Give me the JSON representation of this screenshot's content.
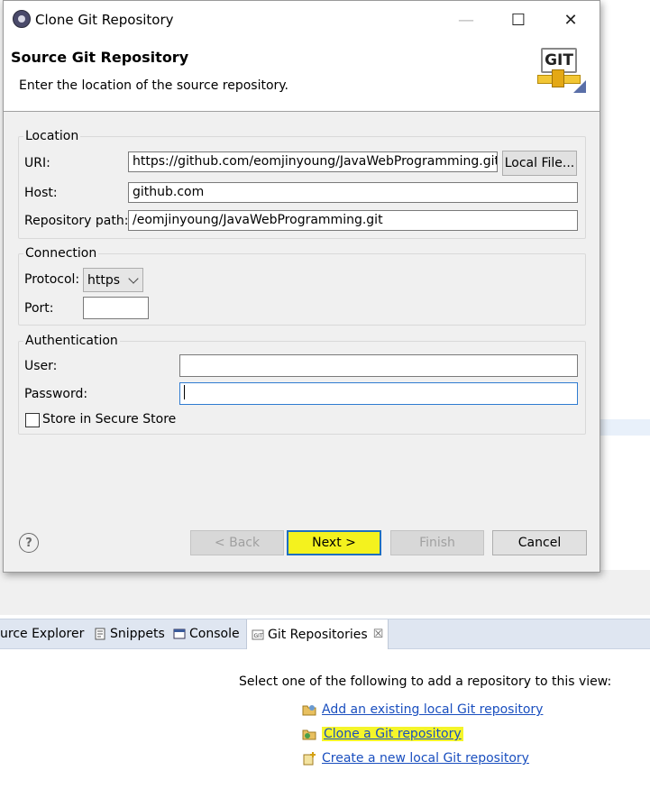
{
  "dialog": {
    "window_title": "Clone Git Repository",
    "controls": {
      "minimize": "—",
      "maximize": "☐",
      "close": "✕"
    },
    "header": {
      "title": "Source Git Repository",
      "description": "Enter the location of the source repository.",
      "logo_text": "GIT"
    },
    "location": {
      "group_label": "Location",
      "uri_label": "URI:",
      "uri_value": "https://github.com/eomjinyoung/JavaWebProgramming.git",
      "local_file_button": "Local File...",
      "host_label": "Host:",
      "host_value": "github.com",
      "repo_path_label": "Repository path:",
      "repo_path_value": "/eomjinyoung/JavaWebProgramming.git"
    },
    "connection": {
      "group_label": "Connection",
      "protocol_label": "Protocol:",
      "protocol_value": "https",
      "port_label": "Port:",
      "port_value": ""
    },
    "authentication": {
      "group_label": "Authentication",
      "user_label": "User:",
      "user_value": "",
      "password_label": "Password:",
      "password_value": "",
      "store_label": "Store in Secure Store",
      "store_checked": false
    },
    "footer": {
      "help_symbol": "?",
      "back": "< Back",
      "next": "Next >",
      "finish": "Finish",
      "cancel": "Cancel"
    }
  },
  "background": {
    "tabs": [
      {
        "label": "urce Explorer",
        "icon": "source-explorer-icon"
      },
      {
        "label": "Snippets",
        "icon": "snippets-icon"
      },
      {
        "label": "Console",
        "icon": "console-icon"
      },
      {
        "label": "Git Repositories",
        "icon": "git-repositories-icon",
        "active": true,
        "close": "☒"
      }
    ],
    "view_message": "Select one of the following to add a repository to this view:",
    "links": [
      {
        "label": "Add an existing local Git repository",
        "icon": "add-repository-icon"
      },
      {
        "label": "Clone a Git repository",
        "icon": "clone-repository-icon",
        "highlighted": true
      },
      {
        "label": "Create a new local Git repository",
        "icon": "create-repository-icon"
      }
    ]
  },
  "colors": {
    "highlight": "#f4f52a",
    "link": "#1a4fbf",
    "focus_border": "#2f7bd1",
    "dialog_bg": "#f0f0f0"
  }
}
